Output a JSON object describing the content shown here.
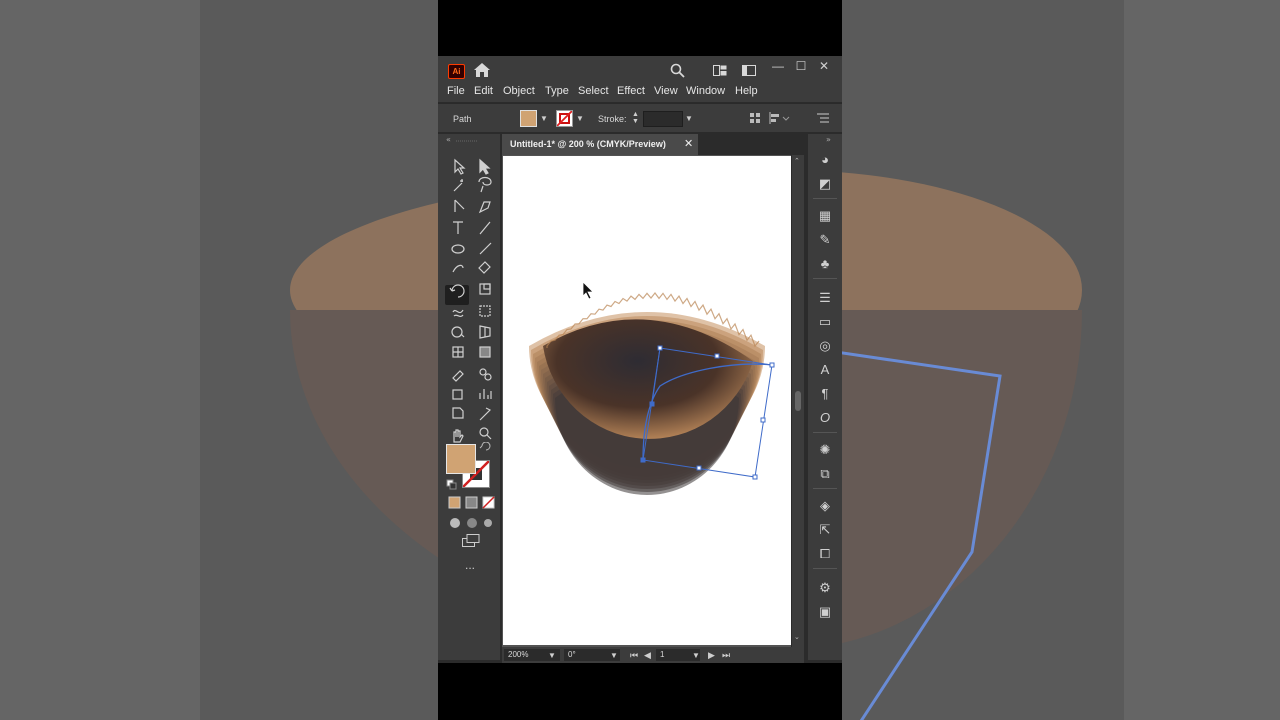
{
  "app": {
    "logo_text": "Ai",
    "window_controls": {
      "minimize": "—",
      "maximize": "☐",
      "close": "✕"
    }
  },
  "menu": [
    "File",
    "Edit",
    "Object",
    "Type",
    "Select",
    "Effect",
    "View",
    "Window",
    "Help"
  ],
  "control_bar": {
    "selection_label": "Path",
    "stroke_label": "Stroke:",
    "fill_color": "#D0A373"
  },
  "document": {
    "tab_label": "Untitled-1* @ 200 % (CMYK/Preview)",
    "close_glyph": "✕"
  },
  "status": {
    "zoom": "200%",
    "rotation": "0°",
    "artboard_number": "1"
  },
  "toolbox": {
    "more_label": "...",
    "fill_color": "#D0A373",
    "active_tool": "rotate-tool"
  },
  "artwork": {
    "shape": "bowl of rotated copies",
    "gradient_stops": [
      "#C48F5E",
      "#2E2C33"
    ],
    "selection_color": "#3F6BC9"
  }
}
